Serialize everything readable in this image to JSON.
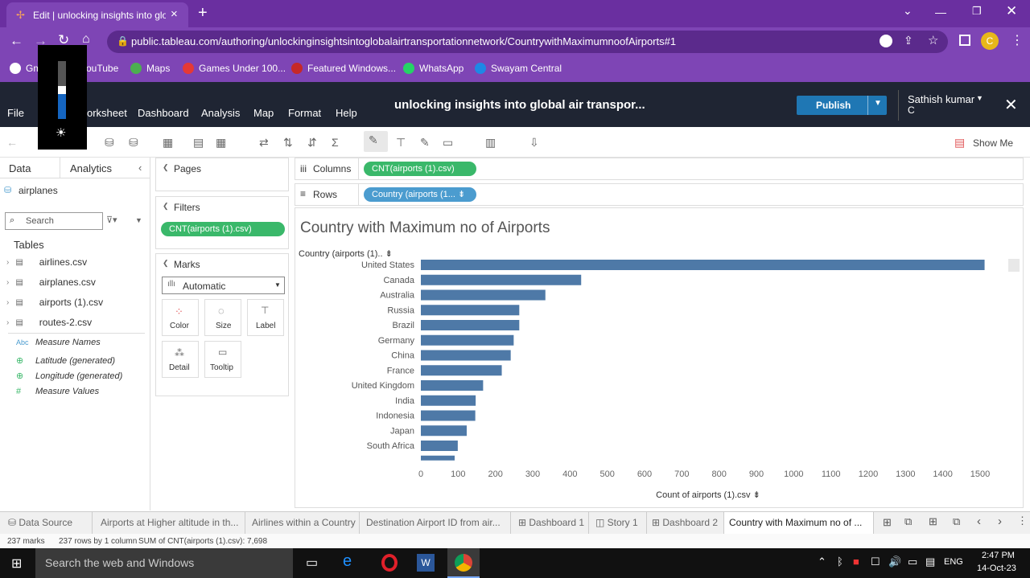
{
  "browser": {
    "tab_title": "Edit | unlocking insights into glo",
    "url": "public.tableau.com/authoring/unlockinginsightsintoglobalairtransportationnetwork/CountrywithMaximumnoofAirports#1",
    "bookmarks": [
      "Gm",
      "ouTube",
      "Maps",
      "Games Under 100...",
      "Featured Windows...",
      "WhatsApp",
      "Swayam Central"
    ],
    "profile_initial": "C"
  },
  "tableau": {
    "menus": [
      "File",
      "orksheet",
      "Dashboard",
      "Analysis",
      "Map",
      "Format",
      "Help"
    ],
    "workbook_title": "unlocking insights into global air transpor...",
    "publish_label": "Publish",
    "user_name": "Sathish kumar",
    "user_initial": "C",
    "show_me": "Show Me"
  },
  "left_panel": {
    "tabs": [
      "Data",
      "Analytics"
    ],
    "datasource": "airplanes",
    "search_placeholder": "Search",
    "tables_header": "Tables",
    "tables": [
      "airlines.csv",
      "airplanes.csv",
      "airports (1).csv",
      "routes-2.csv"
    ],
    "fields": [
      {
        "type": "Abc",
        "name": "Measure Names"
      },
      {
        "type": "globe",
        "name": "Latitude (generated)"
      },
      {
        "type": "globe",
        "name": "Longitude (generated)"
      },
      {
        "type": "#",
        "name": "Measure Values"
      }
    ]
  },
  "shelves": {
    "pages_label": "Pages",
    "filters_label": "Filters",
    "filter_pill": "CNT(airports (1).csv)",
    "marks_label": "Marks",
    "marks_type": "Automatic",
    "mark_buttons": [
      "Color",
      "Size",
      "Label",
      "Detail",
      "Tooltip"
    ],
    "columns_label": "Columns",
    "columns_pill": "CNT(airports (1).csv)",
    "rows_label": "Rows",
    "rows_pill": "Country (airports (1..."
  },
  "chart_data": {
    "type": "bar",
    "title": "Country with Maximum no of Airports",
    "row_header": "Country (airports (1)..",
    "xlabel": "Count of airports (1).csv",
    "xlim": [
      0,
      1550
    ],
    "xticks": [
      0,
      100,
      200,
      300,
      400,
      500,
      600,
      700,
      800,
      900,
      1000,
      1100,
      1200,
      1300,
      1400,
      1500
    ],
    "categories": [
      "United States",
      "Canada",
      "Australia",
      "Russia",
      "Brazil",
      "Germany",
      "China",
      "France",
      "United Kingdom",
      "India",
      "Indonesia",
      "Japan",
      "South Africa"
    ],
    "values": [
      1512,
      430,
      334,
      264,
      264,
      249,
      241,
      217,
      167,
      147,
      146,
      123,
      99
    ],
    "color": "#4e79a7"
  },
  "sheet_tabs": [
    "Data Source",
    "Airports at Higher altitude in th...",
    "Airlines within a Country",
    "Destination Airport ID from air...",
    "Dashboard 1",
    "Story 1",
    "Dashboard 2",
    "Country with Maximum no of ..."
  ],
  "status": {
    "marks": "237 marks",
    "rows": "237 rows by 1 column",
    "sum": "SUM of CNT(airports (1).csv): 7,698"
  },
  "taskbar": {
    "search_placeholder": "Search the web and Windows",
    "lang": "ENG",
    "time": "2:47 PM",
    "date": "14-Oct-23"
  }
}
